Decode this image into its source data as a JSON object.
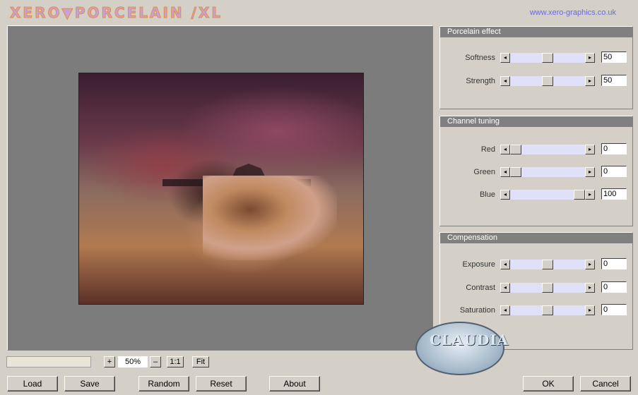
{
  "header": {
    "logo_text": "XERO▼PORCELAIN /XL",
    "website": "www.xero-graphics.co.uk"
  },
  "zoom": {
    "plus_label": "+",
    "value": "50%",
    "minus_label": "–",
    "one_to_one_label": "1:1",
    "fit_label": "Fit"
  },
  "buttons": {
    "load": "Load",
    "save": "Save",
    "random": "Random",
    "reset": "Reset",
    "about": "About",
    "ok": "OK",
    "cancel": "Cancel"
  },
  "groups": [
    {
      "title": "Porcelain effect",
      "params": [
        {
          "label": "Softness",
          "value": "50",
          "level": 0.5
        },
        {
          "label": "Strength",
          "value": "50",
          "level": 0.5
        }
      ]
    },
    {
      "title": "Channel tuning",
      "params": [
        {
          "label": "Red",
          "value": "0",
          "level": 0.0
        },
        {
          "label": "Green",
          "value": "0",
          "level": 0.0
        },
        {
          "label": "Blue",
          "value": "100",
          "level": 1.0
        }
      ]
    },
    {
      "title": "Compensation",
      "params": [
        {
          "label": "Exposure",
          "value": "0",
          "level": 0.5
        },
        {
          "label": "Contrast",
          "value": "0",
          "level": 0.5
        },
        {
          "label": "Saturation",
          "value": "0",
          "level": 0.5
        }
      ]
    }
  ],
  "watermark": {
    "text": "CLAUDIA"
  }
}
